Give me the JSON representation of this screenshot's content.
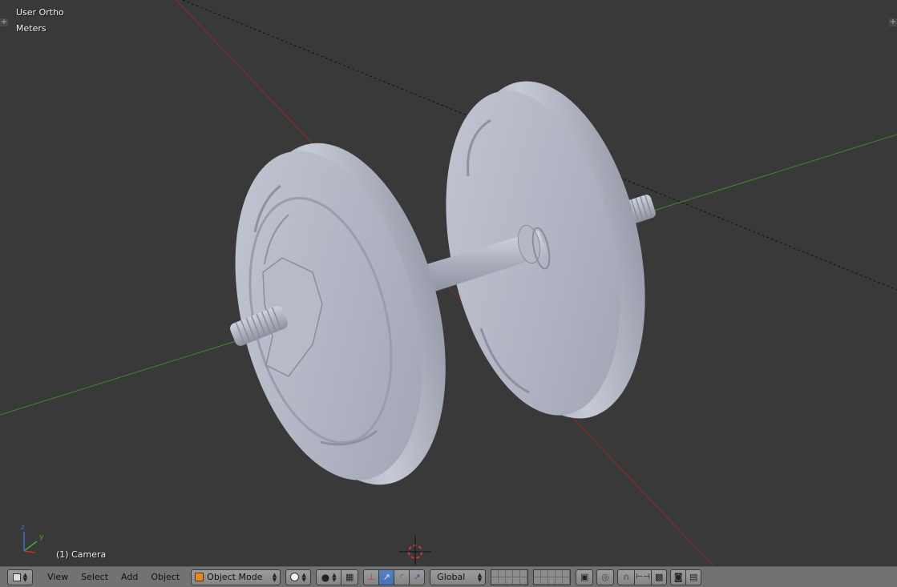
{
  "viewport": {
    "view_label": "User Ortho",
    "units_label": "Meters",
    "active_object_label": "(1) Camera",
    "background_color": "#393939",
    "x_axis_color": "#8f2a2a",
    "y_axis_color": "#3d8a2a",
    "mesh_color": "#b4b8c8"
  },
  "header": {
    "editor_type_icon": "cube-icon",
    "menus": [
      "View",
      "Select",
      "Add",
      "Object"
    ],
    "mode_dropdown": {
      "label": "Object Mode",
      "icon": "cube-orange-icon"
    },
    "shading_icon": "sphere-icon",
    "pivot_icon": "pivot-icon",
    "manipulator_icons": [
      "manipulator-icon",
      "translate-icon",
      "rotate-icon",
      "scale-icon"
    ],
    "orientation_dropdown": {
      "label": "Global"
    },
    "layers_icon": "layers-icon",
    "lock_camera_icon": "lock-icon",
    "proportional_icon": "proportional-icon",
    "snap_icons": [
      "magnet-icon",
      "snap-element-icon",
      "snap-target-icon"
    ],
    "render_icons": [
      "render-icon",
      "clapperboard-icon"
    ]
  }
}
